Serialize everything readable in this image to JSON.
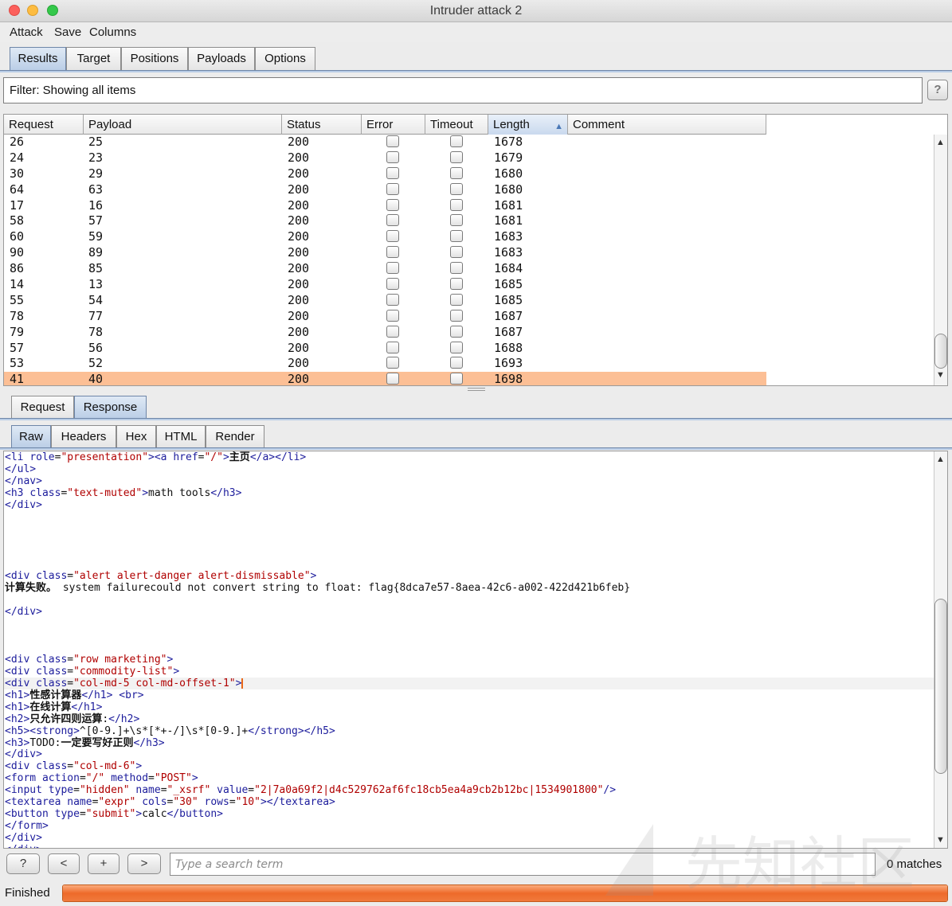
{
  "window": {
    "title": "Intruder attack 2"
  },
  "menu": [
    "Attack",
    "Save",
    "Columns"
  ],
  "main_tabs": [
    {
      "label": "Results",
      "active": true
    },
    {
      "label": "Target",
      "active": false
    },
    {
      "label": "Positions",
      "active": false
    },
    {
      "label": "Payloads",
      "active": false
    },
    {
      "label": "Options",
      "active": false
    }
  ],
  "filter": {
    "text": "Filter: Showing all items",
    "help": "?"
  },
  "table": {
    "columns": [
      "Request",
      "Payload",
      "Status",
      "Error",
      "Timeout",
      "Length",
      "Comment"
    ],
    "sort_column": "Length",
    "sort_arrow": "▲",
    "rows": [
      {
        "request": "26",
        "payload": "25",
        "status": "200",
        "length": "1678",
        "selected": false
      },
      {
        "request": "24",
        "payload": "23",
        "status": "200",
        "length": "1679",
        "selected": false
      },
      {
        "request": "30",
        "payload": "29",
        "status": "200",
        "length": "1680",
        "selected": false
      },
      {
        "request": "64",
        "payload": "63",
        "status": "200",
        "length": "1680",
        "selected": false
      },
      {
        "request": "17",
        "payload": "16",
        "status": "200",
        "length": "1681",
        "selected": false
      },
      {
        "request": "58",
        "payload": "57",
        "status": "200",
        "length": "1681",
        "selected": false
      },
      {
        "request": "60",
        "payload": "59",
        "status": "200",
        "length": "1683",
        "selected": false
      },
      {
        "request": "90",
        "payload": "89",
        "status": "200",
        "length": "1683",
        "selected": false
      },
      {
        "request": "86",
        "payload": "85",
        "status": "200",
        "length": "1684",
        "selected": false
      },
      {
        "request": "14",
        "payload": "13",
        "status": "200",
        "length": "1685",
        "selected": false
      },
      {
        "request": "55",
        "payload": "54",
        "status": "200",
        "length": "1685",
        "selected": false
      },
      {
        "request": "78",
        "payload": "77",
        "status": "200",
        "length": "1687",
        "selected": false
      },
      {
        "request": "79",
        "payload": "78",
        "status": "200",
        "length": "1687",
        "selected": false
      },
      {
        "request": "57",
        "payload": "56",
        "status": "200",
        "length": "1688",
        "selected": false
      },
      {
        "request": "53",
        "payload": "52",
        "status": "200",
        "length": "1693",
        "selected": false
      },
      {
        "request": "41",
        "payload": "40",
        "status": "200",
        "length": "1698",
        "selected": true
      }
    ]
  },
  "reqres_tabs": [
    {
      "label": "Request",
      "active": false
    },
    {
      "label": "Response",
      "active": true
    }
  ],
  "view_tabs": [
    {
      "label": "Raw",
      "active": true
    },
    {
      "label": "Headers",
      "active": false
    },
    {
      "label": "Hex",
      "active": false
    },
    {
      "label": "HTML",
      "active": false
    },
    {
      "label": "Render",
      "active": false
    }
  ],
  "response_lines": [
    [
      [
        "tg",
        "<li "
      ],
      [
        "at",
        "role"
      ],
      [
        "tx",
        "="
      ],
      [
        "vl",
        "\"presentation\""
      ],
      [
        "tg",
        "><a "
      ],
      [
        "at",
        "href"
      ],
      [
        "tx",
        "="
      ],
      [
        "vl",
        "\"/\""
      ],
      [
        "tg",
        ">"
      ],
      [
        "cn",
        "主页"
      ],
      [
        "tg",
        "</a></li>"
      ]
    ],
    [
      [
        "tg",
        "</ul>"
      ]
    ],
    [
      [
        "tg",
        "</nav>"
      ]
    ],
    [
      [
        "tg",
        "<h3 "
      ],
      [
        "at",
        "class"
      ],
      [
        "tx",
        "="
      ],
      [
        "vl",
        "\"text-muted\""
      ],
      [
        "tg",
        ">"
      ],
      [
        "tx",
        "math tools"
      ],
      [
        "tg",
        "</h3>"
      ]
    ],
    [
      [
        "tg",
        "</div>"
      ]
    ],
    [],
    [],
    [],
    [],
    [],
    [
      [
        "tg",
        "<div "
      ],
      [
        "at",
        "class"
      ],
      [
        "tx",
        "="
      ],
      [
        "vl",
        "\"alert alert-danger alert-dismissable\""
      ],
      [
        "tg",
        ">"
      ]
    ],
    [
      [
        "cn",
        "计算失败。"
      ],
      [
        "tx",
        " system failurecould not convert string to float: flag{8dca7e57-8aea-42c6-a002-422d421b6feb}"
      ]
    ],
    [],
    [
      [
        "tg",
        "</div>"
      ]
    ],
    [],
    [],
    [],
    [
      [
        "tg",
        "<div "
      ],
      [
        "at",
        "class"
      ],
      [
        "tx",
        "="
      ],
      [
        "vl",
        "\"row marketing\""
      ],
      [
        "tg",
        ">"
      ]
    ],
    [
      [
        "tg",
        "<div "
      ],
      [
        "at",
        "class"
      ],
      [
        "tx",
        "="
      ],
      [
        "vl",
        "\"commodity-list\""
      ],
      [
        "tg",
        ">"
      ]
    ],
    [
      [
        "tg",
        "<div "
      ],
      [
        "at",
        "class"
      ],
      [
        "tx",
        "="
      ],
      [
        "vl",
        "\"col-md-5 col-md-offset-1\""
      ],
      [
        "tg",
        ">"
      ],
      [
        "caret",
        ""
      ]
    ],
    [
      [
        "tg",
        "<h1>"
      ],
      [
        "cn",
        "性感计算器"
      ],
      [
        "tg",
        "</h1> <br>"
      ]
    ],
    [
      [
        "tg",
        "<h1>"
      ],
      [
        "cn",
        "在线计算"
      ],
      [
        "tg",
        "</h1>"
      ]
    ],
    [
      [
        "tg",
        "<h2>"
      ],
      [
        "cn",
        "只允许四则运算"
      ],
      [
        "tx",
        ":"
      ],
      [
        "tg",
        "</h2>"
      ]
    ],
    [
      [
        "tg",
        "<h5><strong>"
      ],
      [
        "tx",
        "^[0-9.]+\\s*[*+-/]\\s*[0-9.]+"
      ],
      [
        "tg",
        "</strong></h5>"
      ]
    ],
    [
      [
        "tg",
        "<h3>"
      ],
      [
        "tx",
        "TODO:"
      ],
      [
        "cn",
        "一定要写好正则"
      ],
      [
        "tg",
        "</h3>"
      ]
    ],
    [
      [
        "tg",
        "</div>"
      ]
    ],
    [
      [
        "tg",
        "<div "
      ],
      [
        "at",
        "class"
      ],
      [
        "tx",
        "="
      ],
      [
        "vl",
        "\"col-md-6\""
      ],
      [
        "tg",
        ">"
      ]
    ],
    [
      [
        "tg",
        "<form "
      ],
      [
        "at",
        "action"
      ],
      [
        "tx",
        "="
      ],
      [
        "vl",
        "\"/\""
      ],
      [
        "tx",
        " "
      ],
      [
        "at",
        "method"
      ],
      [
        "tx",
        "="
      ],
      [
        "vl",
        "\"POST\""
      ],
      [
        "tg",
        ">"
      ]
    ],
    [
      [
        "tg",
        "<input "
      ],
      [
        "at",
        "type"
      ],
      [
        "tx",
        "="
      ],
      [
        "vl",
        "\"hidden\""
      ],
      [
        "tx",
        " "
      ],
      [
        "at",
        "name"
      ],
      [
        "tx",
        "="
      ],
      [
        "vl",
        "\"_xsrf\""
      ],
      [
        "tx",
        " "
      ],
      [
        "at",
        "value"
      ],
      [
        "tx",
        "="
      ],
      [
        "vl",
        "\"2|7a0a69f2|d4c529762af6fc18cb5ea4a9cb2b12bc|1534901800\""
      ],
      [
        "tg",
        "/>"
      ]
    ],
    [
      [
        "tg",
        "<textarea "
      ],
      [
        "at",
        "name"
      ],
      [
        "tx",
        "="
      ],
      [
        "vl",
        "\"expr\""
      ],
      [
        "tx",
        " "
      ],
      [
        "at",
        "cols"
      ],
      [
        "tx",
        "="
      ],
      [
        "vl",
        "\"30\""
      ],
      [
        "tx",
        " "
      ],
      [
        "at",
        "rows"
      ],
      [
        "tx",
        "="
      ],
      [
        "vl",
        "\"10\""
      ],
      [
        "tg",
        "></textarea>"
      ]
    ],
    [
      [
        "tg",
        "<button "
      ],
      [
        "at",
        "type"
      ],
      [
        "tx",
        "="
      ],
      [
        "vl",
        "\"submit\""
      ],
      [
        "tg",
        ">"
      ],
      [
        "tx",
        "calc"
      ],
      [
        "tg",
        "</button>"
      ]
    ],
    [
      [
        "tg",
        "</form>"
      ]
    ],
    [
      [
        "tg",
        "</div>"
      ]
    ],
    [
      [
        "tg",
        "</div>"
      ]
    ]
  ],
  "search": {
    "help": "?",
    "prev": "<",
    "add": "+",
    "next": ">",
    "placeholder": "Type a search term",
    "matches": "0 matches"
  },
  "status": {
    "text": "Finished",
    "progress": 1.0
  },
  "watermark": "先知社区"
}
